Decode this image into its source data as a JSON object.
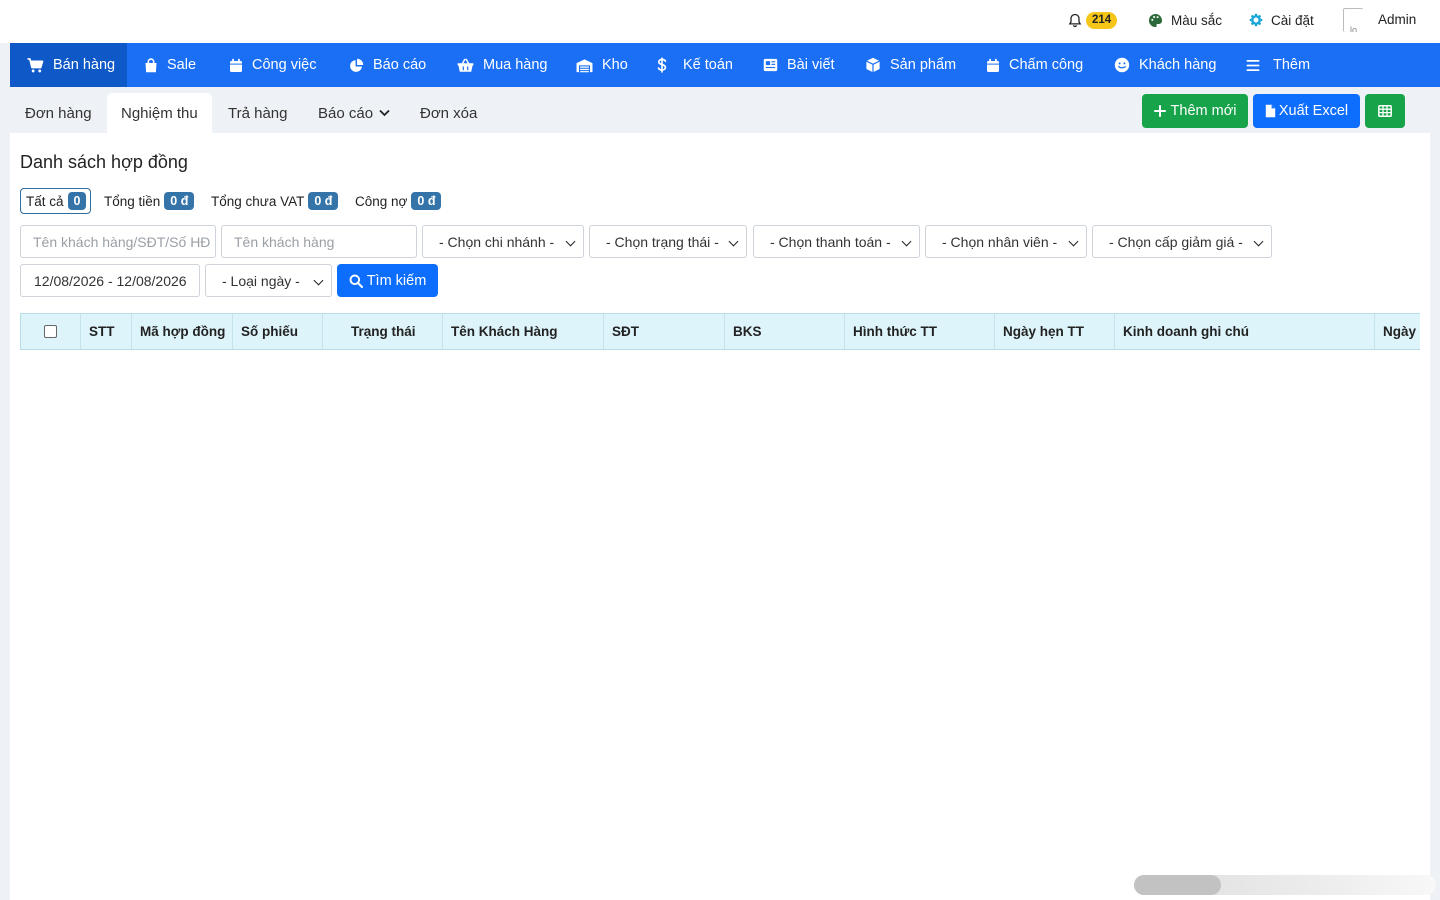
{
  "topbar": {
    "notification_count": "214",
    "color_label": "Màu sắc",
    "settings_label": "Cài đặt",
    "user_name": "Admin"
  },
  "mainnav": [
    {
      "label": "Bán hàng",
      "icon": "cart-icon",
      "active": true
    },
    {
      "label": "Sale",
      "icon": "shopping-bag-icon"
    },
    {
      "label": "Công việc",
      "icon": "calendar-icon"
    },
    {
      "label": "Báo cáo",
      "icon": "pie-chart-icon"
    },
    {
      "label": "Mua hàng",
      "icon": "basket-icon"
    },
    {
      "label": "Kho",
      "icon": "warehouse-icon"
    },
    {
      "label": "Kế toán",
      "icon": "dollar-icon"
    },
    {
      "label": "Bài viết",
      "icon": "newspaper-icon"
    },
    {
      "label": "Sản phẩm",
      "icon": "box-icon"
    },
    {
      "label": "Chấm công",
      "icon": "calendar-icon"
    },
    {
      "label": "Khách hàng",
      "icon": "smile-icon"
    },
    {
      "label": "Thêm",
      "icon": "menu-icon"
    }
  ],
  "subnav": {
    "tabs": [
      {
        "label": "Đơn hàng"
      },
      {
        "label": "Nghiệm thu",
        "active": true
      },
      {
        "label": "Trả hàng"
      },
      {
        "label": "Báo cáo",
        "dropdown": true
      },
      {
        "label": "Đơn xóa"
      }
    ],
    "add_button": "Thêm mới",
    "export_button": "Xuất Excel"
  },
  "page": {
    "title": "Danh sách hợp đồng",
    "stats": [
      {
        "label": "Tất cả",
        "value": "0"
      },
      {
        "label": "Tổng tiền",
        "value": "0 đ"
      },
      {
        "label": "Tổng chưa VAT",
        "value": "0 đ"
      },
      {
        "label": "Công nợ",
        "value": "0 đ"
      }
    ]
  },
  "filters": {
    "customer_search_placeholder": "Tên khách hàng/SĐT/Số HĐ",
    "customer_name_placeholder": "Tên khách hàng",
    "branch": "- Chọn chi nhánh -",
    "status": "- Chọn trạng thái -",
    "payment": "- Chọn thanh toán -",
    "staff": "- Chọn nhân viên -",
    "discount": "- Chọn cấp giảm giá -",
    "date_range": "12/08/2026 - 12/08/2026",
    "date_type": "- Loại ngày -",
    "search_button": "Tìm kiếm"
  },
  "table": {
    "columns": [
      "STT",
      "Mã hợp đồng",
      "Số phiếu",
      "Trạng thái",
      "Tên Khách Hàng",
      "SĐT",
      "BKS",
      "Hình thức TT",
      "Ngày hẹn TT",
      "Kinh doanh ghi chú",
      "Ngày lập"
    ]
  },
  "colors": {
    "nav_blue": "#1a6ff5",
    "nav_active": "#0f58c8",
    "success_green": "#16a34a",
    "primary_blue": "#0d6efd",
    "table_header_bg": "#ddf4fb",
    "badge_blue": "#3474a8",
    "notification_yellow": "#f5c518"
  }
}
